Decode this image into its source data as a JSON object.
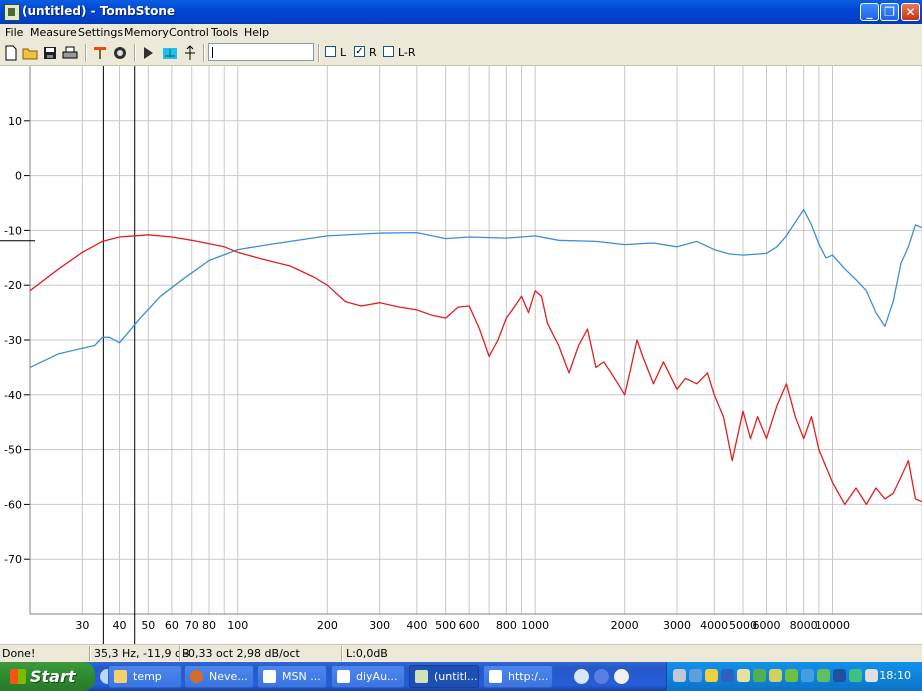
{
  "window": {
    "title": "(untitled) - TombStone"
  },
  "menu": [
    "File",
    "Measure",
    "Settings",
    "Memory",
    "Control",
    "Tools",
    "Help"
  ],
  "toolbar": {
    "input_value": "",
    "checkboxes": [
      {
        "label": "L",
        "checked": false
      },
      {
        "label": "R",
        "checked": true
      },
      {
        "label": "L-R",
        "checked": false
      }
    ]
  },
  "status": {
    "state": "Done!",
    "cursor": "35,3 Hz, -11,9 dB",
    "slope": "-0,33 oct 2,98 dB/oct",
    "level": "L:0,0dB"
  },
  "taskbar": {
    "start_label": "Start",
    "tasks": [
      {
        "label": "temp",
        "icon_color": "#f2d16b"
      },
      {
        "label": "Neve...",
        "icon_color": "#d86a2a"
      },
      {
        "label": "MSN ...",
        "icon_color": "#ffffff"
      },
      {
        "label": "diyAu...",
        "icon_color": "#ffffff"
      },
      {
        "label": "(untitl...",
        "icon_color": "#cfe3b8",
        "active": true
      },
      {
        "label": "http:/...",
        "icon_color": "#ffffff"
      }
    ],
    "clock": "18:10"
  },
  "chart_data": {
    "type": "line",
    "xscale": "log",
    "xlim": [
      20,
      20000
    ],
    "ylim": [
      -80,
      20
    ],
    "grid": true,
    "yticks": [
      10,
      0,
      -10,
      -20,
      -30,
      -40,
      -50,
      -60,
      -70
    ],
    "xticks": [
      "30",
      "40",
      "50",
      "60",
      "70",
      "80",
      "100",
      "200",
      "300",
      "400",
      "500",
      "600",
      "800",
      "1000",
      "2000",
      "3000",
      "4000",
      "5000",
      "6000",
      "8000",
      "10000"
    ],
    "xtick_values": [
      30,
      40,
      50,
      60,
      70,
      80,
      100,
      200,
      300,
      400,
      500,
      600,
      800,
      1000,
      2000,
      3000,
      4000,
      5000,
      6000,
      8000,
      10000
    ],
    "minor_x": [
      90,
      700,
      900,
      7000,
      9000,
      20000
    ],
    "markers_hz": [
      35.3,
      45
    ],
    "series": [
      {
        "color": "#3a8fd6",
        "points": [
          [
            20,
            -35
          ],
          [
            25,
            -32.5
          ],
          [
            30,
            -31.5
          ],
          [
            33,
            -31
          ],
          [
            35,
            -29.5
          ],
          [
            37,
            -29.5
          ],
          [
            40,
            -30.5
          ],
          [
            43,
            -28.5
          ],
          [
            47,
            -26
          ],
          [
            55,
            -22
          ],
          [
            65,
            -19
          ],
          [
            80,
            -15.5
          ],
          [
            100,
            -13.5
          ],
          [
            130,
            -12.5
          ],
          [
            200,
            -11
          ],
          [
            300,
            -10.5
          ],
          [
            400,
            -10.4
          ],
          [
            500,
            -11.5
          ],
          [
            600,
            -11.2
          ],
          [
            800,
            -11.4
          ],
          [
            1000,
            -11
          ],
          [
            1200,
            -11.8
          ],
          [
            1600,
            -12
          ],
          [
            2000,
            -12.6
          ],
          [
            2500,
            -12.3
          ],
          [
            3000,
            -13
          ],
          [
            3500,
            -12
          ],
          [
            4000,
            -13.5
          ],
          [
            4500,
            -14.3
          ],
          [
            5000,
            -14.5
          ],
          [
            6000,
            -14.2
          ],
          [
            6500,
            -13
          ],
          [
            7000,
            -11
          ],
          [
            7500,
            -8.5
          ],
          [
            8000,
            -6.2
          ],
          [
            8500,
            -9
          ],
          [
            9000,
            -12.5
          ],
          [
            9500,
            -15
          ],
          [
            10000,
            -14.5
          ],
          [
            11000,
            -17
          ],
          [
            12000,
            -19
          ],
          [
            13000,
            -21
          ],
          [
            14000,
            -25
          ],
          [
            15000,
            -27.5
          ],
          [
            16000,
            -23
          ],
          [
            17000,
            -16
          ],
          [
            18000,
            -13
          ],
          [
            19000,
            -9
          ],
          [
            20000,
            -9.5
          ]
        ]
      },
      {
        "color": "#e02020",
        "points": [
          [
            20,
            -21
          ],
          [
            25,
            -17
          ],
          [
            30,
            -14
          ],
          [
            35,
            -12
          ],
          [
            40,
            -11.2
          ],
          [
            50,
            -10.8
          ],
          [
            60,
            -11.2
          ],
          [
            70,
            -11.8
          ],
          [
            90,
            -13
          ],
          [
            100,
            -14
          ],
          [
            120,
            -15.2
          ],
          [
            150,
            -16.5
          ],
          [
            180,
            -18.5
          ],
          [
            200,
            -20
          ],
          [
            230,
            -23
          ],
          [
            260,
            -23.8
          ],
          [
            300,
            -23.2
          ],
          [
            350,
            -24
          ],
          [
            400,
            -24.5
          ],
          [
            450,
            -25.5
          ],
          [
            500,
            -26
          ],
          [
            550,
            -24
          ],
          [
            600,
            -23.8
          ],
          [
            650,
            -28
          ],
          [
            700,
            -33
          ],
          [
            750,
            -30
          ],
          [
            800,
            -26
          ],
          [
            850,
            -24
          ],
          [
            900,
            -22
          ],
          [
            950,
            -25
          ],
          [
            1000,
            -21
          ],
          [
            1050,
            -22
          ],
          [
            1100,
            -27
          ],
          [
            1200,
            -31
          ],
          [
            1300,
            -36
          ],
          [
            1400,
            -31
          ],
          [
            1500,
            -28
          ],
          [
            1600,
            -35
          ],
          [
            1700,
            -34
          ],
          [
            1800,
            -36
          ],
          [
            1900,
            -38
          ],
          [
            2000,
            -40
          ],
          [
            2100,
            -35
          ],
          [
            2200,
            -30
          ],
          [
            2300,
            -33
          ],
          [
            2500,
            -38
          ],
          [
            2700,
            -34
          ],
          [
            3000,
            -39
          ],
          [
            3200,
            -37
          ],
          [
            3500,
            -38
          ],
          [
            3800,
            -36
          ],
          [
            4000,
            -40
          ],
          [
            4300,
            -44
          ],
          [
            4600,
            -52
          ],
          [
            5000,
            -43
          ],
          [
            5300,
            -48
          ],
          [
            5600,
            -44
          ],
          [
            6000,
            -48
          ],
          [
            6500,
            -42
          ],
          [
            7000,
            -38
          ],
          [
            7500,
            -44
          ],
          [
            8000,
            -48
          ],
          [
            8500,
            -44
          ],
          [
            9000,
            -50
          ],
          [
            10000,
            -56
          ],
          [
            11000,
            -60
          ],
          [
            12000,
            -57
          ],
          [
            13000,
            -60
          ],
          [
            14000,
            -57
          ],
          [
            15000,
            -59
          ],
          [
            16000,
            -58
          ],
          [
            17000,
            -55
          ],
          [
            18000,
            -52
          ],
          [
            19000,
            -59
          ],
          [
            20000,
            -59.5
          ]
        ]
      }
    ]
  }
}
